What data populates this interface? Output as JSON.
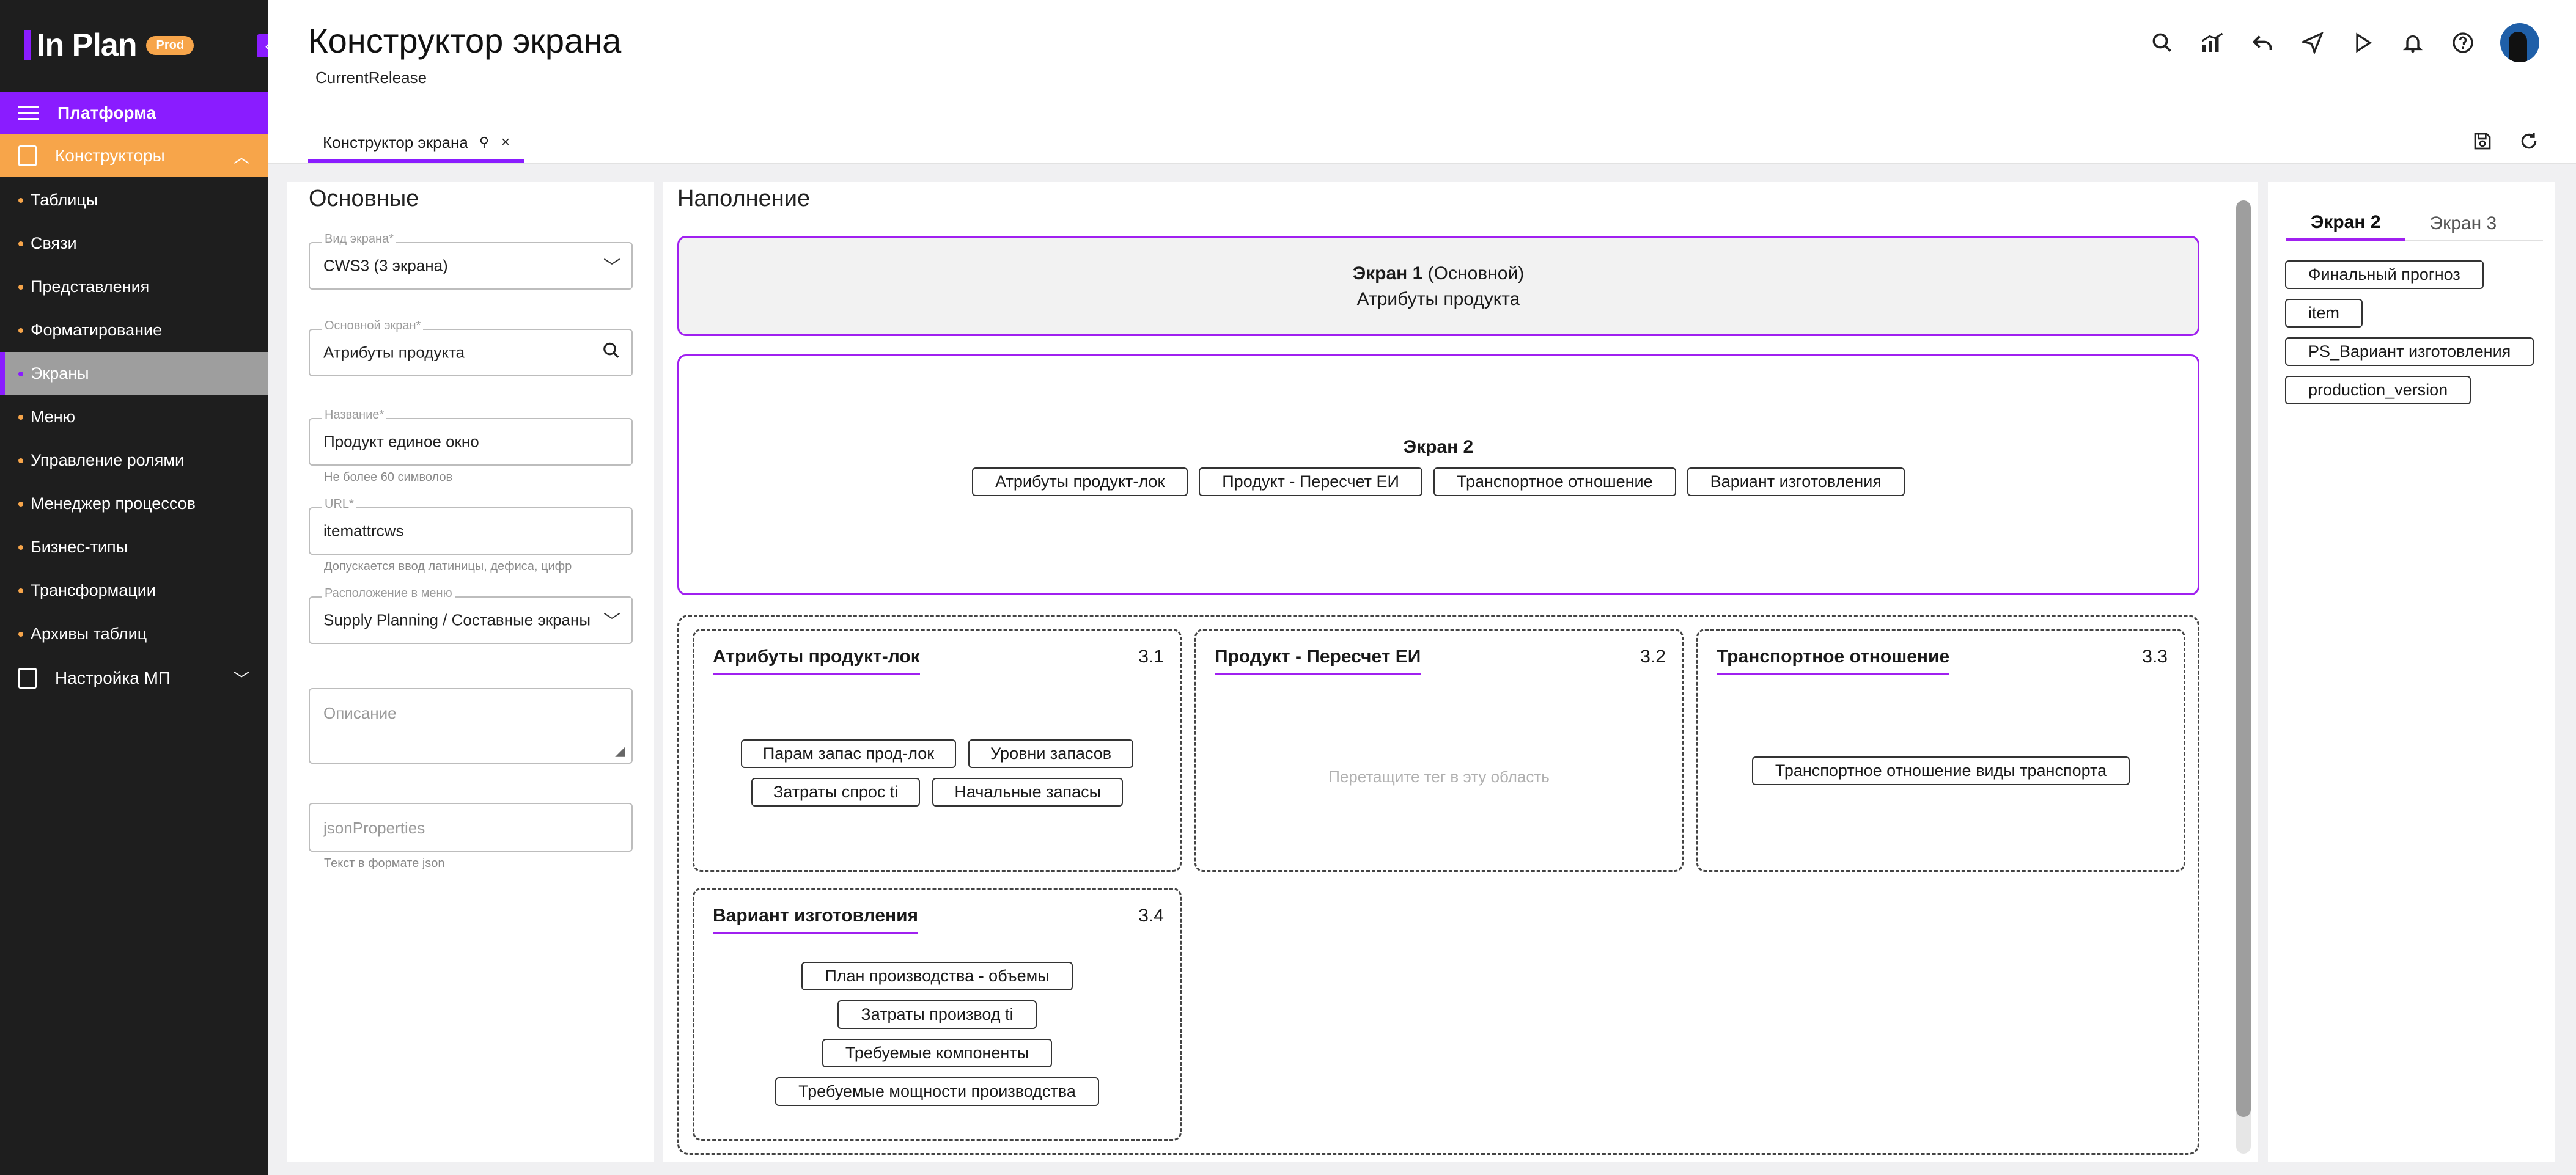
{
  "app": {
    "logo": "In Plan",
    "badge": "Prod"
  },
  "sidebar": {
    "platform": "Платформа",
    "constructors": "Конструкторы",
    "items": [
      {
        "label": "Таблицы"
      },
      {
        "label": "Связи"
      },
      {
        "label": "Представления"
      },
      {
        "label": "Форматирование"
      },
      {
        "label": "Экраны",
        "active": true
      },
      {
        "label": "Меню"
      },
      {
        "label": "Управление ролями"
      },
      {
        "label": "Менеджер процессов"
      },
      {
        "label": "Бизнес-типы"
      },
      {
        "label": "Трансформации"
      },
      {
        "label": "Архивы таблиц"
      }
    ],
    "mp_settings": "Настройка МП"
  },
  "header": {
    "title": "Конструктор экрана",
    "release": "CurrentRelease",
    "tab_label": "Конструктор экрана"
  },
  "form": {
    "section_title": "Основные",
    "screen_type": {
      "label": "Вид экрана*",
      "value": "CWS3 (3 экрана)"
    },
    "main_screen": {
      "label": "Основной экран*",
      "value": "Атрибуты продукта"
    },
    "name": {
      "label": "Название*",
      "value": "Продукт единое окно",
      "hint": "Не более 60 символов"
    },
    "url": {
      "label": "URL*",
      "value": "itemattrcws",
      "hint": "Допускается ввод латиницы, дефиса, цифр"
    },
    "menu_location": {
      "label": "Расположение в меню",
      "value": "Supply Planning / Составные экраны"
    },
    "description": {
      "placeholder": "Описание"
    },
    "json_props": {
      "placeholder": "jsonProperties",
      "hint": "Текст в формате json"
    }
  },
  "content": {
    "section_title": "Наполнение",
    "screen1": {
      "name": "Экран 1",
      "suffix": "(Основной)",
      "subtitle": "Атрибуты продукта"
    },
    "screen2": {
      "title": "Экран 2",
      "tags": [
        "Атрибуты продукт-лок",
        "Продукт - Пересчет ЕИ",
        "Транспортное отношение",
        "Вариант изготовления"
      ]
    },
    "screen3": {
      "subs": [
        {
          "title": "Атрибуты продукт-лок",
          "num": "3.1",
          "tags": [
            "Парам запас прод-лок",
            "Уровни запасов",
            "Затраты спрос ti",
            "Начальные запасы"
          ]
        },
        {
          "title": "Продукт - Пересчет ЕИ",
          "num": "3.2",
          "placeholder": "Перетащите тег в эту область"
        },
        {
          "title": "Транспортное отношение",
          "num": "3.3",
          "tags": [
            "Транспортное отношение виды транспорта"
          ]
        },
        {
          "title": "Вариант изготовления",
          "num": "3.4",
          "tags": [
            "План производства - объемы",
            "Затраты производ ti",
            "Требуемые компоненты",
            "Требуемые мощности производства"
          ]
        }
      ]
    }
  },
  "right": {
    "tabs": [
      "Экран 2",
      "Экран 3"
    ],
    "tags": [
      "Финальный прогноз",
      "item",
      "PS_Вариант изготовления",
      "production_version"
    ]
  },
  "colors": {
    "accent": "#8a1cff",
    "orange": "#f7a54a",
    "sidebar_bg": "#1e1e1e"
  }
}
